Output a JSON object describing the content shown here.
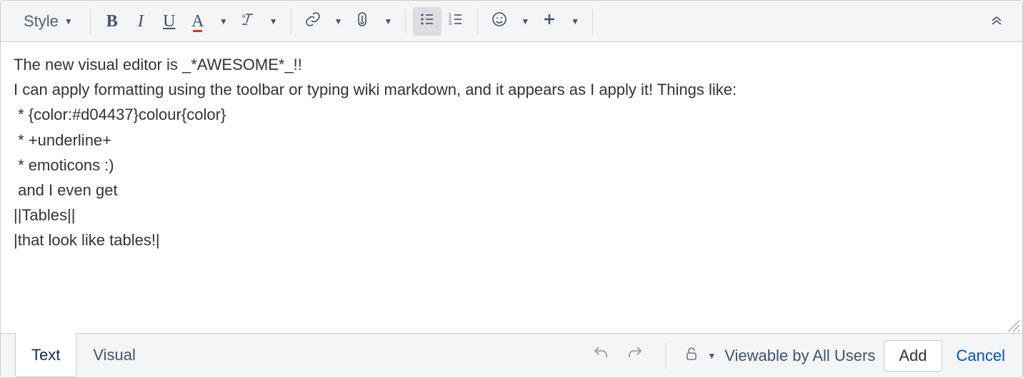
{
  "toolbar": {
    "style_label": "Style",
    "icons": {
      "bold": "B",
      "italic": "I",
      "underline": "U",
      "textcolor": "A",
      "clearfmt": "clear-formatting",
      "link": "link",
      "attachment": "attachment",
      "bullet_list": "bulleted-list",
      "numbered_list": "numbered-list",
      "emoji": "emoji",
      "insert_more": "insert-more",
      "expand": "expand-panel"
    }
  },
  "editor": {
    "content": "The new visual editor is _*AWESOME*_!!\nI can apply formatting using the toolbar or typing wiki markdown, and it appears as I apply it! Things like:\n * {color:#d04437}colour{color}\n * +underline+\n * emoticons :)\n and I even get\n||Tables||\n|that look like tables!|"
  },
  "footer": {
    "tabs": [
      {
        "label": "Text",
        "active": true
      },
      {
        "label": "Visual",
        "active": false
      }
    ],
    "visibility_label": "Viewable by All Users",
    "add_label": "Add",
    "cancel_label": "Cancel"
  }
}
